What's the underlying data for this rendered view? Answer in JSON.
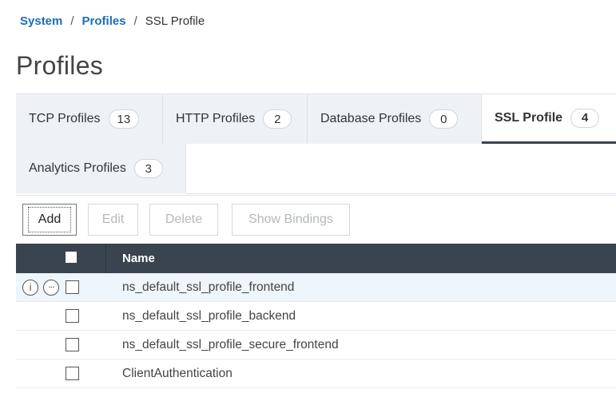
{
  "breadcrumb": {
    "items": [
      "System",
      "Profiles",
      "SSL Profile"
    ],
    "separator": "/"
  },
  "page": {
    "title": "Profiles"
  },
  "tabs": [
    {
      "label": "TCP Profiles",
      "count": "13"
    },
    {
      "label": "HTTP Profiles",
      "count": "2"
    },
    {
      "label": "Database Profiles",
      "count": "0"
    },
    {
      "label": "SSL Profile",
      "count": "4",
      "active": true
    },
    {
      "label": "Analytics Profiles",
      "count": "3"
    }
  ],
  "toolbar": {
    "add_label": "Add",
    "edit_label": "Edit",
    "delete_label": "Delete",
    "show_bindings_label": "Show Bindings"
  },
  "table": {
    "columns": [
      "Name"
    ],
    "rows": [
      {
        "name": "ns_default_ssl_profile_frontend"
      },
      {
        "name": "ns_default_ssl_profile_backend"
      },
      {
        "name": "ns_default_ssl_profile_secure_frontend"
      },
      {
        "name": "ClientAuthentication"
      }
    ],
    "row_actions": {
      "info_icon": "i",
      "more_icon": "···"
    }
  },
  "colors": {
    "link": "#1a6fb8",
    "header_bg": "#3a4450",
    "tab_bg": "#eef2f6",
    "row_highlight": "#eef5fb"
  }
}
